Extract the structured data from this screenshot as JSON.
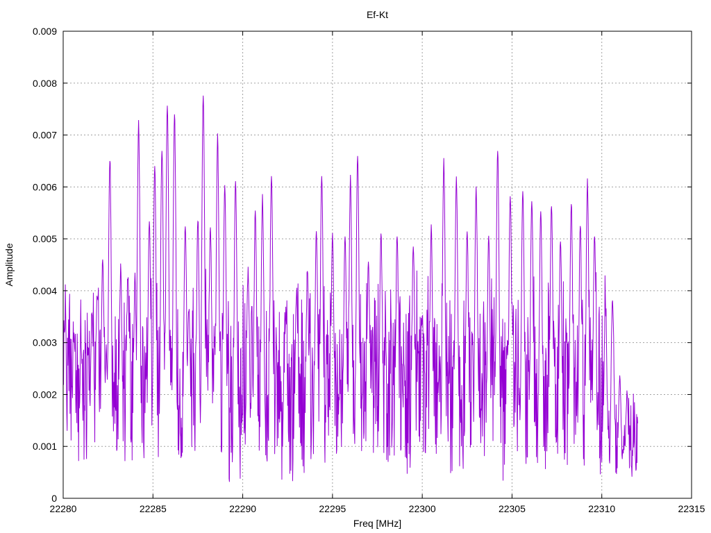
{
  "chart_data": {
    "type": "line",
    "title": "Ef-Kt",
    "xlabel": "Freq [MHz]",
    "ylabel": "Amplitude",
    "xlim": [
      22280,
      22315
    ],
    "ylim": [
      0,
      0.009
    ],
    "x_ticks": [
      22280,
      22285,
      22290,
      22295,
      22300,
      22305,
      22310,
      22315
    ],
    "y_ticks": [
      0,
      0.001,
      0.002,
      0.003,
      0.004,
      0.005,
      0.006,
      0.007,
      0.008,
      0.009
    ],
    "x_tick_labels": [
      "22280",
      "22285",
      "22290",
      "22295",
      "22300",
      "22305",
      "22310",
      "22315"
    ],
    "y_tick_labels": [
      "0",
      "0.001",
      "0.002",
      "0.003",
      "0.004",
      "0.005",
      "0.006",
      "0.007",
      "0.008",
      "0.009"
    ],
    "grid": true,
    "legend": "none",
    "series": [
      {
        "color": "#9400d3",
        "sampling": {
          "x_start": 22280.0,
          "x_end": 22312.0,
          "step": 0.02
        },
        "peaks": [
          {
            "x": 22280.1,
            "y": 0.0035
          },
          {
            "x": 22280.6,
            "y": 0.0033
          },
          {
            "x": 22281.0,
            "y": 0.003
          },
          {
            "x": 22281.6,
            "y": 0.0038
          },
          {
            "x": 22281.9,
            "y": 0.0043
          },
          {
            "x": 22282.2,
            "y": 0.0047
          },
          {
            "x": 22282.4,
            "y": 0.003
          },
          {
            "x": 22282.6,
            "y": 0.0067
          },
          {
            "x": 22283.2,
            "y": 0.0046
          },
          {
            "x": 22283.6,
            "y": 0.0044
          },
          {
            "x": 22284.0,
            "y": 0.0044
          },
          {
            "x": 22284.2,
            "y": 0.0074
          },
          {
            "x": 22284.8,
            "y": 0.0055
          },
          {
            "x": 22285.1,
            "y": 0.0066
          },
          {
            "x": 22285.5,
            "y": 0.0069
          },
          {
            "x": 22285.8,
            "y": 0.0078
          },
          {
            "x": 22286.2,
            "y": 0.0076
          },
          {
            "x": 22286.8,
            "y": 0.0054
          },
          {
            "x": 22287.0,
            "y": 0.004
          },
          {
            "x": 22287.5,
            "y": 0.0055
          },
          {
            "x": 22287.8,
            "y": 0.008
          },
          {
            "x": 22288.2,
            "y": 0.0053
          },
          {
            "x": 22288.6,
            "y": 0.0071
          },
          {
            "x": 22289.0,
            "y": 0.0062
          },
          {
            "x": 22289.6,
            "y": 0.0063
          },
          {
            "x": 22290.3,
            "y": 0.0046
          },
          {
            "x": 22290.7,
            "y": 0.0056
          },
          {
            "x": 22291.1,
            "y": 0.0059
          },
          {
            "x": 22291.6,
            "y": 0.0064
          },
          {
            "x": 22292.4,
            "y": 0.0038
          },
          {
            "x": 22293.0,
            "y": 0.0042
          },
          {
            "x": 22293.6,
            "y": 0.0045
          },
          {
            "x": 22294.1,
            "y": 0.0053
          },
          {
            "x": 22294.4,
            "y": 0.0064
          },
          {
            "x": 22295.0,
            "y": 0.0052
          },
          {
            "x": 22295.7,
            "y": 0.0052
          },
          {
            "x": 22296.0,
            "y": 0.0063
          },
          {
            "x": 22296.4,
            "y": 0.0068
          },
          {
            "x": 22297.0,
            "y": 0.0047
          },
          {
            "x": 22297.7,
            "y": 0.0052
          },
          {
            "x": 22298.6,
            "y": 0.0052
          },
          {
            "x": 22299.5,
            "y": 0.005
          },
          {
            "x": 22300.5,
            "y": 0.0053
          },
          {
            "x": 22301.2,
            "y": 0.0066
          },
          {
            "x": 22301.9,
            "y": 0.0063
          },
          {
            "x": 22302.5,
            "y": 0.0053
          },
          {
            "x": 22303.0,
            "y": 0.0061
          },
          {
            "x": 22303.7,
            "y": 0.0052
          },
          {
            "x": 22304.2,
            "y": 0.0069
          },
          {
            "x": 22304.9,
            "y": 0.006
          },
          {
            "x": 22305.6,
            "y": 0.0061
          },
          {
            "x": 22306.1,
            "y": 0.0059
          },
          {
            "x": 22306.6,
            "y": 0.0057
          },
          {
            "x": 22307.2,
            "y": 0.0058
          },
          {
            "x": 22307.7,
            "y": 0.0051
          },
          {
            "x": 22308.3,
            "y": 0.0058
          },
          {
            "x": 22308.8,
            "y": 0.0054
          },
          {
            "x": 22309.2,
            "y": 0.0062
          },
          {
            "x": 22309.6,
            "y": 0.0052
          },
          {
            "x": 22310.2,
            "y": 0.0039
          },
          {
            "x": 22310.6,
            "y": 0.0041
          },
          {
            "x": 22311.0,
            "y": 0.0024
          },
          {
            "x": 22311.4,
            "y": 0.0021
          },
          {
            "x": 22311.8,
            "y": 0.0011
          }
        ],
        "baseline": 0.0024,
        "baseline_end": 0.0012,
        "minimum": 0.0003
      }
    ]
  }
}
